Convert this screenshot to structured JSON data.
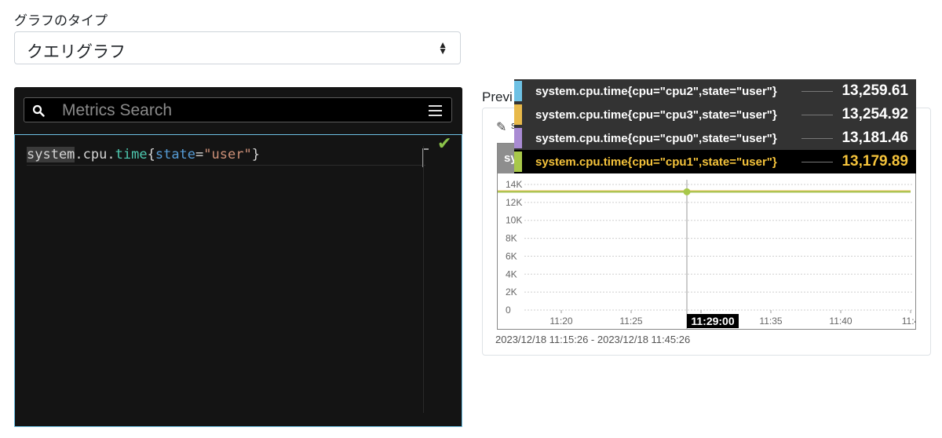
{
  "graph_type": {
    "label": "グラフのタイプ",
    "selected": "クエリグラフ",
    "arrows_icon": "sort-arrows-icon"
  },
  "editor": {
    "search_placeholder": "Metrics Search",
    "search_icon": "search-icon",
    "menu_icon": "hamburger-menu-icon",
    "query": {
      "t1": "system",
      "t2": ".",
      "t3": "cpu",
      "t4": ".",
      "t5": "time",
      "t6": "{",
      "t7": "state",
      "t8": "=",
      "t9": "\"user\"",
      "t10": "}"
    },
    "valid_icon": "checkmark-icon",
    "border_color": "#6ec1e4"
  },
  "preview": {
    "label": "Previ",
    "chart_header_text": "sy",
    "date_range": "2023/12/18 11:15:26 - 2023/12/18 11:45:26",
    "time_marker": "11:29:00",
    "y_ticks": [
      "14K",
      "12K",
      "10K",
      "8K",
      "6K",
      "4K",
      "2K",
      "0"
    ],
    "x_ticks": [
      "11:20",
      "11:25",
      "11:30",
      "11:35",
      "11:40",
      "11:4"
    ]
  },
  "tooltip": {
    "rows": [
      {
        "name": "system.cpu.time{cpu=\"cpu2\",state=\"user\"}",
        "value": "13,259.61",
        "color": "#6ec1e4"
      },
      {
        "name": "system.cpu.time{cpu=\"cpu3\",state=\"user\"}",
        "value": "13,254.92",
        "color": "#e8b94a"
      },
      {
        "name": "system.cpu.time{cpu=\"cpu0\",state=\"user\"}",
        "value": "13,181.46",
        "color": "#a98bd3"
      },
      {
        "name": "system.cpu.time{cpu=\"cpu1\",state=\"user\"}",
        "value": "13,179.89",
        "color": "#a8c84a"
      }
    ]
  },
  "chart_data": {
    "type": "line",
    "ylim": [
      0,
      14000
    ],
    "y_ticks": [
      14000,
      12000,
      10000,
      8000,
      6000,
      4000,
      2000,
      0
    ],
    "x_ticks": [
      "11:20",
      "11:25",
      "11:30",
      "11:35",
      "11:40",
      "11:4"
    ],
    "series": [
      {
        "name": "system.cpu.time{cpu=\"cpu2\",state=\"user\"}",
        "color": "#6ec1e4",
        "values": [
          13259.61,
          13259.61
        ]
      },
      {
        "name": "system.cpu.time{cpu=\"cpu3\",state=\"user\"}",
        "color": "#e8b94a",
        "values": [
          13254.92,
          13254.92
        ]
      },
      {
        "name": "system.cpu.time{cpu=\"cpu0\",state=\"user\"}",
        "color": "#a98bd3",
        "values": [
          13181.46,
          13181.46
        ]
      },
      {
        "name": "system.cpu.time{cpu=\"cpu1\",state=\"user\"}",
        "color": "#a8c84a",
        "values": [
          13179.89,
          13179.89
        ]
      }
    ],
    "hover_time": "11:29:00",
    "grid": true
  }
}
